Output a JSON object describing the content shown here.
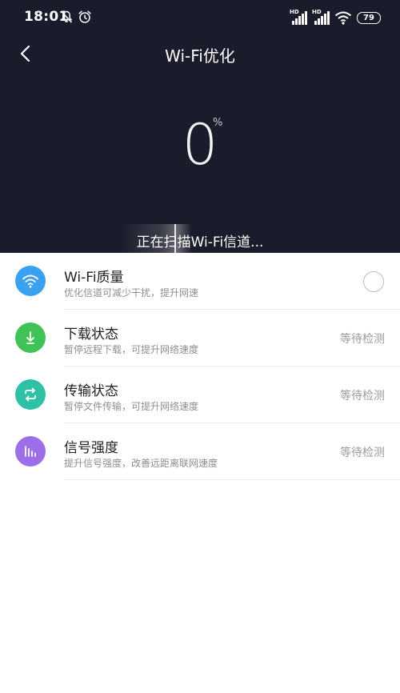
{
  "status_bar": {
    "time": "18:01",
    "icons": [
      "mute-icon",
      "alarm-icon"
    ],
    "signal1_label": "HD",
    "signal2_label": "HD",
    "battery": "79"
  },
  "header": {
    "title": "Wi-Fi优化",
    "back_icon": "chevron-left-icon"
  },
  "progress": {
    "value": "0",
    "unit": "%",
    "scan_text": "正在扫描Wi-Fi信道..."
  },
  "items": [
    {
      "title": "Wi-Fi质量",
      "subtitle": "优化信道可减少干扰，提升网速",
      "status": "",
      "icon": "wifi-icon",
      "color": "#3aa0f0",
      "control": "radio"
    },
    {
      "title": "下载状态",
      "subtitle": "暂停远程下载，可提升网络速度",
      "status": "等待检测",
      "icon": "download-icon",
      "color": "#41c257",
      "control": "status"
    },
    {
      "title": "传输状态",
      "subtitle": "暂停文件传输，可提升网络速度",
      "status": "等待检测",
      "icon": "transfer-icon",
      "color": "#2ec1a6",
      "control": "status"
    },
    {
      "title": "信号强度",
      "subtitle": "提升信号强度，改善远距离联网速度",
      "status": "等待检测",
      "icon": "signal-strength-icon",
      "color": "#9c6ee8",
      "control": "status"
    }
  ],
  "colors": {
    "hero_bg": "#1b1c2b",
    "accent_blue": "#3aa0f0",
    "accent_green": "#41c257",
    "accent_teal": "#2ec1a6",
    "accent_purple": "#9c6ee8"
  }
}
